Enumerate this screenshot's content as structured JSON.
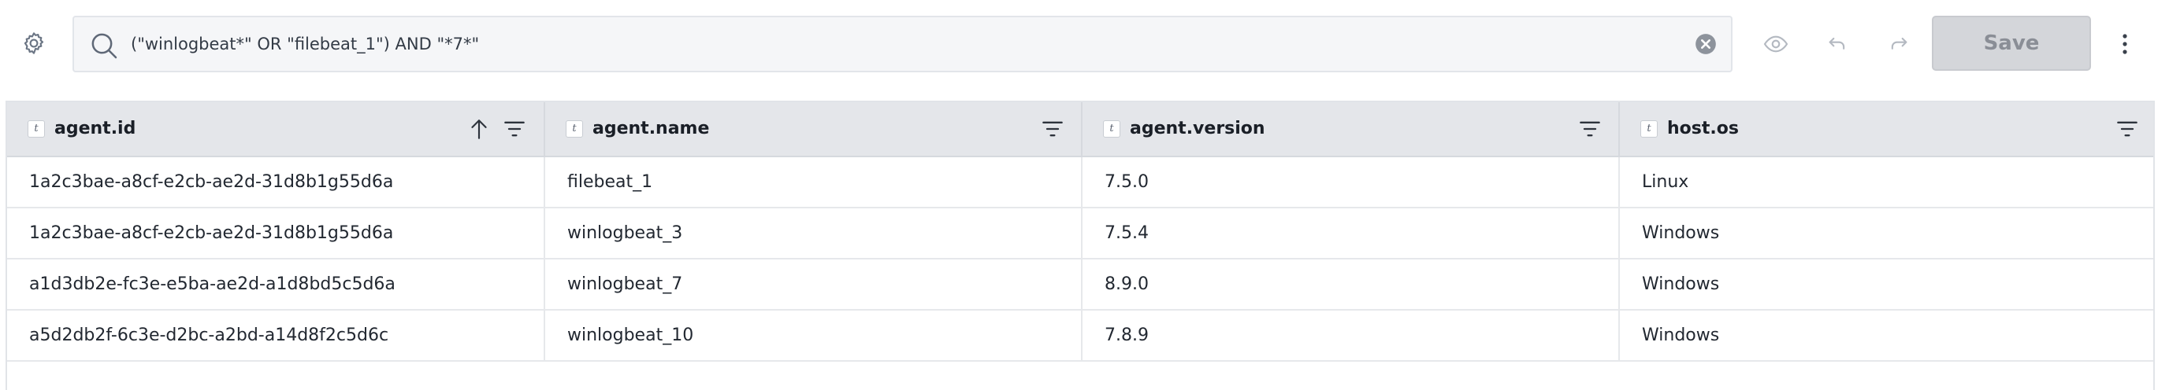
{
  "query": {
    "text": "(\"winlogbeat*\" OR \"filebeat_1\") AND \"*7*\""
  },
  "toolbar": {
    "save_label": "Save"
  },
  "icons": {
    "settings": "gear-icon",
    "search": "search-icon",
    "clear": "clear-icon",
    "preview": "eye-icon",
    "undo": "undo-icon",
    "redo": "redo-icon",
    "more": "vertical-dots-icon"
  },
  "colors": {
    "icon": "#6b7584",
    "save_bg": "#d4d6da",
    "header_bg": "#e4e6ea"
  },
  "table": {
    "columns": [
      {
        "type": "t",
        "label": "agent.id",
        "sorted": "ascending"
      },
      {
        "type": "t",
        "label": "agent.name"
      },
      {
        "type": "t",
        "label": "agent.version"
      },
      {
        "type": "t",
        "label": "host.os"
      }
    ],
    "rows": [
      [
        "1a2c3bae-a8cf-e2cb-ae2d-31d8b1g55d6a",
        "filebeat_1",
        "7.5.0",
        "Linux"
      ],
      [
        "1a2c3bae-a8cf-e2cb-ae2d-31d8b1g55d6a",
        "winlogbeat_3",
        "7.5.4",
        "Windows"
      ],
      [
        "a1d3db2e-fc3e-e5ba-ae2d-a1d8bd5c5d6a",
        "winlogbeat_7",
        "8.9.0",
        "Windows"
      ],
      [
        "a5d2db2f-6c3e-d2bc-a2bd-a14d8f2c5d6c",
        "winlogbeat_10",
        "7.8.9",
        "Windows"
      ]
    ]
  }
}
